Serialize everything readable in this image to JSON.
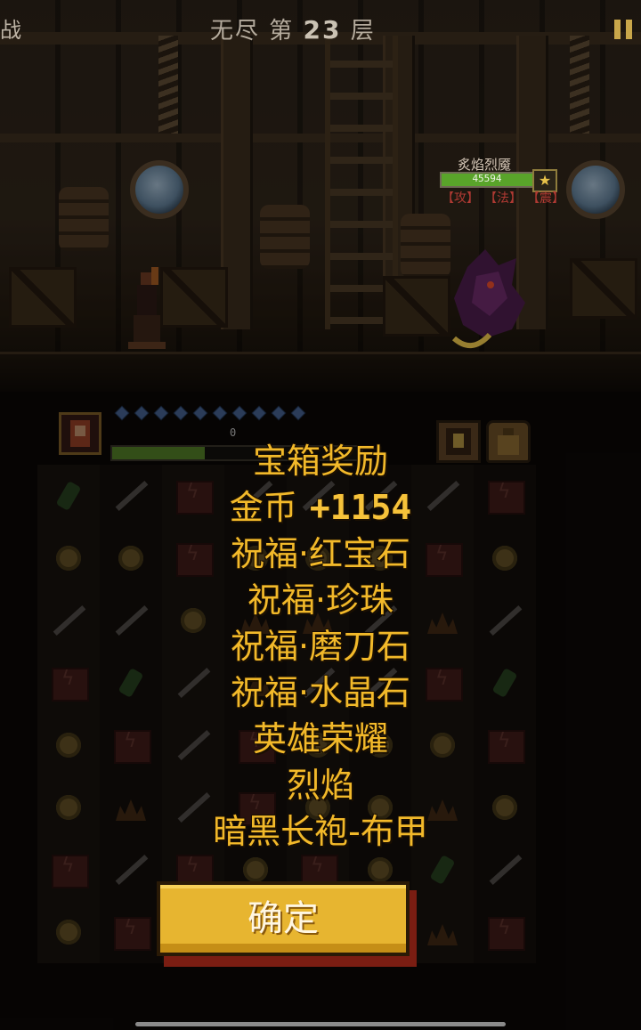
{
  "top": {
    "left_label": "战",
    "floor_prefix": "无尽 第",
    "floor_number": "23",
    "floor_suffix": "层",
    "pause_icon": "pause-icon"
  },
  "enemy": {
    "name": "炙焰烈魇",
    "hp_text": "45594",
    "hp_fraction": 1.0,
    "tags": [
      "【攻】",
      "【法】",
      "【震】"
    ],
    "star_icon": "★"
  },
  "hero": {
    "mana_count": 10,
    "hp_text": "0",
    "hp_fraction": 0.37
  },
  "board": {
    "rows": [
      [
        "potion",
        "sword",
        "book",
        "sword",
        "sword",
        "sword",
        "sword",
        "book"
      ],
      [
        "coin",
        "coin",
        "book",
        "coin",
        "coin",
        "coin",
        "book",
        "coin"
      ],
      [
        "sword",
        "sword",
        "coin",
        "flame",
        "flame",
        "sword",
        "flame",
        "sword"
      ],
      [
        "book",
        "potion",
        "sword",
        "flame",
        "sword",
        "sword",
        "book",
        "potion"
      ],
      [
        "coin",
        "book",
        "sword",
        "book",
        "coin",
        "coin",
        "coin",
        "book"
      ],
      [
        "coin",
        "flame",
        "sword",
        "book",
        "coin",
        "coin",
        "flame",
        "coin"
      ],
      [
        "book",
        "sword",
        "book",
        "coin",
        "book",
        "coin",
        "potion",
        "sword"
      ],
      [
        "coin",
        "book",
        "coin",
        "coin",
        "book",
        "coin",
        "flame",
        "book"
      ]
    ]
  },
  "reward": {
    "title": "宝箱奖励",
    "gold_label": "金币",
    "gold_amount": "+1154",
    "items": [
      "祝福·红宝石",
      "祝福·珍珠",
      "祝福·磨刀石",
      "祝福·水晶石",
      "英雄荣耀",
      "烈焰",
      "暗黑长袍-布甲"
    ],
    "confirm_label": "确定"
  },
  "colors": {
    "reward_text": "#f2b92a",
    "button_face": "#e7b530",
    "button_shadow": "#7a1d12",
    "enemy_tag": "#b03a33",
    "hp_green": "#59a42a"
  }
}
